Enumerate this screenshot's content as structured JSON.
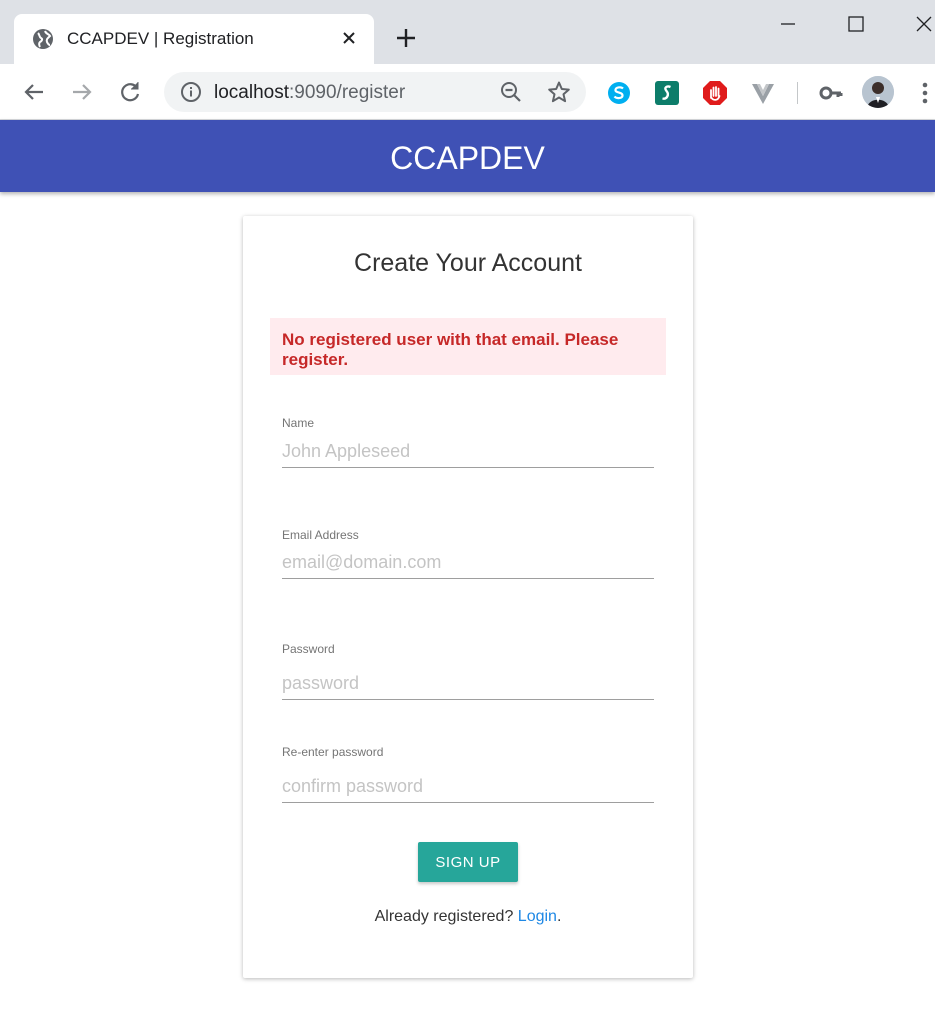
{
  "browser": {
    "tab_title": "CCAPDEV | Registration",
    "url_host": "localhost",
    "url_rest": ":9090/register"
  },
  "icons": {
    "tab": "globe-icon",
    "extensions": [
      "skype-icon",
      "s-extension-icon",
      "stop-hand-icon",
      "v-extension-icon",
      "key-icon"
    ],
    "profile": "avatar"
  },
  "colors": {
    "appbar": "#3f51b5",
    "button": "#26a69a",
    "alert_bg": "#ffebee",
    "alert_text": "#c62828",
    "link": "#1e88e5"
  },
  "appbar": {
    "title": "CCAPDEV"
  },
  "form": {
    "heading": "Create Your Account",
    "alert": "No registered user with that email. Please register.",
    "fields": {
      "name": {
        "label": "Name",
        "placeholder": "John Appleseed"
      },
      "email": {
        "label": "Email Address",
        "placeholder": "email@domain.com"
      },
      "password": {
        "label": "Password",
        "placeholder": "password"
      },
      "confirm": {
        "label": "Re-enter password",
        "placeholder": "confirm password"
      }
    },
    "submit_label": "SIGN UP",
    "footer_text": "Already registered?",
    "login_link": "Login",
    "footer_period": "."
  }
}
